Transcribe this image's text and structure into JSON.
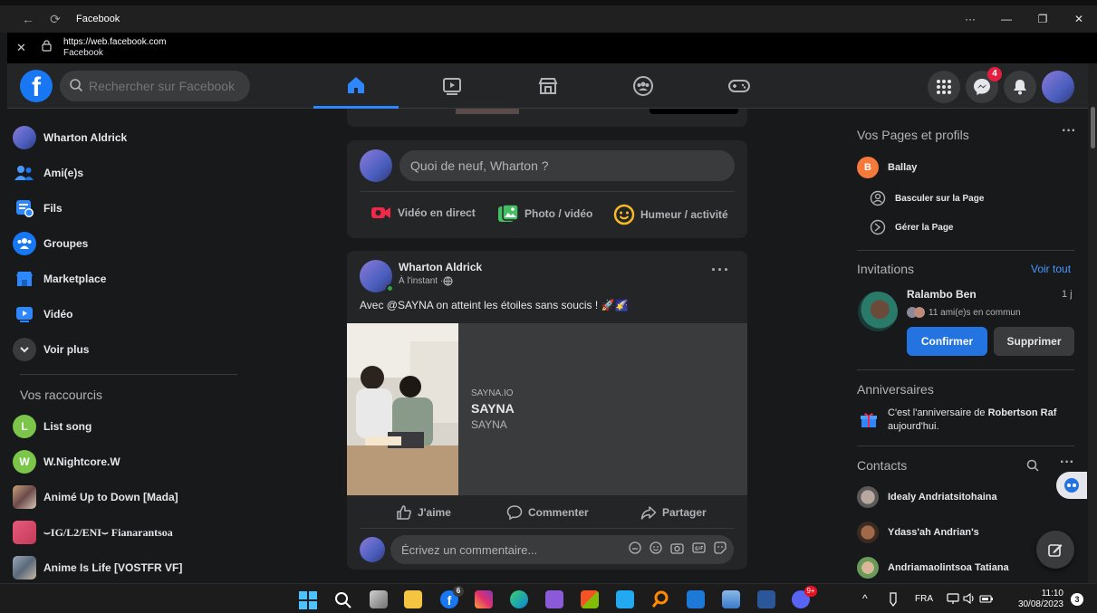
{
  "window": {
    "title": "Facebook",
    "url": "https://web.facebook.com",
    "page_name": "Facebook"
  },
  "nav": {
    "search_placeholder": "Rechercher sur Facebook",
    "messenger_badge": "4"
  },
  "left": {
    "items": [
      {
        "label": "Wharton Aldrick",
        "icon": "profile-avatar"
      },
      {
        "label": "Ami(e)s",
        "icon": "friends-icon"
      },
      {
        "label": "Fils",
        "icon": "feeds-icon"
      },
      {
        "label": "Groupes",
        "icon": "groups-icon"
      },
      {
        "label": "Marketplace",
        "icon": "marketplace-icon"
      },
      {
        "label": "Vidéo",
        "icon": "video-icon"
      },
      {
        "label": "Voir plus",
        "icon": "chevron-down-icon"
      }
    ],
    "shortcuts_title": "Vos raccourcis",
    "shortcuts": [
      {
        "label": "List song",
        "letter": "L",
        "color": "#7bc64a"
      },
      {
        "label": "W.Nightcore.W",
        "letter": "W",
        "color": "#7bc64a"
      },
      {
        "label": "Animé Up to Down [Mada]",
        "letter": "",
        "color": "#8a6a5a"
      },
      {
        "label": "⌣IG/L2/ENI⌣ Fianarantsoa",
        "letter": "",
        "color": "#c8506a"
      },
      {
        "label": "Anime Is Life [VOSTFR VF]",
        "letter": "",
        "color": "#7a8a9a"
      }
    ]
  },
  "composer": {
    "placeholder": "Quoi de neuf, Wharton ?",
    "live_label": "Vidéo en direct",
    "photo_label": "Photo / vidéo",
    "feeling_label": "Humeur / activité"
  },
  "post": {
    "author": "Wharton Aldrick",
    "time": "À l'instant · ",
    "text": "Avec @SAYNA on atteint les étoiles sans soucis ! 🚀🌠",
    "link_domain": "SAYNA.IO",
    "link_title": "SAYNA",
    "link_subtitle": "SAYNA",
    "like_label": "J'aime",
    "comment_label": "Commenter",
    "share_label": "Partager",
    "comment_placeholder": "Écrivez un commentaire..."
  },
  "right": {
    "pages_title": "Vos Pages et profils",
    "page_name": "Ballay",
    "page_letter": "B",
    "switch_label": "Basculer sur la Page",
    "manage_label": "Gérer la Page",
    "invitations_title": "Invitations",
    "see_all": "Voir tout",
    "invite_name": "Ralambo Ben",
    "invite_time": "1 j",
    "mutual": "11 ami(e)s en commun",
    "confirm": "Confirmer",
    "delete": "Supprimer",
    "birthdays_title": "Anniversaires",
    "birthday_prefix": "C'est l'anniversaire de ",
    "birthday_name": "Robertson Raf",
    "birthday_suffix": "aujourd'hui.",
    "contacts_title": "Contacts",
    "contacts": [
      "Idealy Andriatsitohaina",
      "Ydass'ah Andrian's",
      "Andriamaolintsoa Tatiana"
    ]
  },
  "taskbar": {
    "lang": "FRA",
    "time": "11:10",
    "date": "30/08/2023",
    "fb_badge": "6",
    "discord_badge": "9+",
    "notif_count": "3"
  },
  "colors": {
    "accent": "#2d88ff",
    "bg": "#18191a",
    "card": "#242526"
  }
}
